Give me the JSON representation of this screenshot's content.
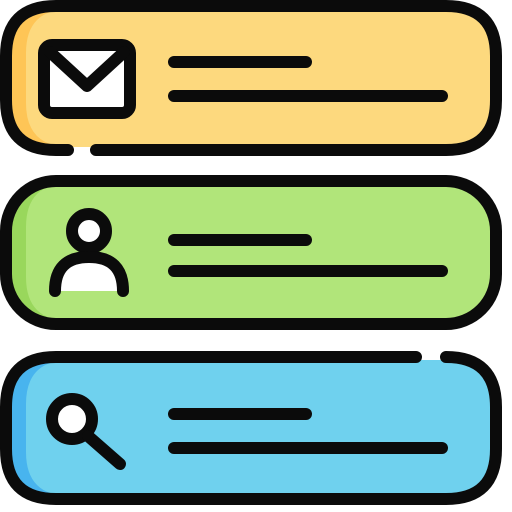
{
  "rows": [
    {
      "id": "mail",
      "icon": "envelope-icon",
      "fill": "#fdd97e",
      "shade": "#fec556"
    },
    {
      "id": "profile",
      "icon": "user-icon",
      "fill": "#b1e57a",
      "shade": "#99d75c"
    },
    {
      "id": "search",
      "icon": "magnifier-icon",
      "fill": "#6fd1ee",
      "shade": "#48b4ee"
    }
  ],
  "outline": "#0b0b0b",
  "glyph_fill": "#ffffff"
}
